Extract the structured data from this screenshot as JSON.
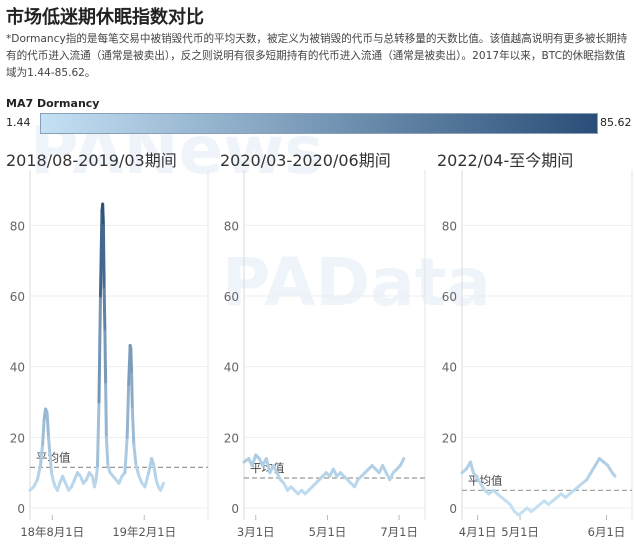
{
  "page": {
    "title": "市场低迷期休眠指数对比",
    "description": "*Dormancy指的是每笔交易中被销毁代币的平均天数，被定义为被销毁的代币与总转移量的天数比值。该值越高说明有更多被长期持有的代币进入流通（通常是被卖出），反之则说明有很多短期持有的代币进入流通（通常是被卖出）。2017年以来，BTC的休眠指数值域为1.44-85.62。"
  },
  "legend": {
    "title": "MA7 Dormancy",
    "min_label": "1.44",
    "max_label": "85.62",
    "color_low": "#c4e1f4",
    "color_high": "#2a4e78"
  },
  "watermarks": [
    "PANews",
    "PAData"
  ],
  "avg_label": "平均值",
  "chart_data": [
    {
      "type": "line",
      "title": "2018/08-2019/03期间",
      "ylim": [
        0,
        90
      ],
      "yticks": [
        0,
        20,
        40,
        60,
        80
      ],
      "xlim": [
        0,
        240
      ],
      "xticks": [
        {
          "x": 30,
          "label": "18年8月1日"
        },
        {
          "x": 154,
          "label": "19年2月1日"
        }
      ],
      "average": 11.5,
      "series": [
        {
          "points": [
            [
              0,
              5
            ],
            [
              5,
              6
            ],
            [
              10,
              8
            ],
            [
              14,
              12
            ],
            [
              17,
              18
            ],
            [
              19,
              25
            ],
            [
              21,
              28
            ],
            [
              23,
              27
            ],
            [
              25,
              20
            ],
            [
              27,
              15
            ],
            [
              29,
              10
            ],
            [
              31,
              8
            ],
            [
              34,
              6
            ],
            [
              37,
              5
            ],
            [
              40,
              7
            ],
            [
              44,
              9
            ],
            [
              48,
              7
            ],
            [
              52,
              5
            ],
            [
              56,
              6
            ],
            [
              60,
              8
            ],
            [
              64,
              10
            ],
            [
              68,
              9
            ],
            [
              72,
              7
            ],
            [
              76,
              8
            ],
            [
              80,
              10
            ],
            [
              84,
              9
            ],
            [
              87,
              6
            ],
            [
              89,
              8
            ],
            [
              91,
              12
            ],
            [
              93,
              30
            ],
            [
              95,
              60
            ],
            [
              97,
              84
            ],
            [
              98,
              86
            ],
            [
              99,
              80
            ],
            [
              100,
              62
            ],
            [
              101,
              50
            ],
            [
              102,
              35
            ],
            [
              103,
              20
            ],
            [
              105,
              12
            ],
            [
              108,
              10
            ],
            [
              112,
              9
            ],
            [
              116,
              8
            ],
            [
              120,
              7
            ],
            [
              124,
              9
            ],
            [
              128,
              10
            ],
            [
              131,
              20
            ],
            [
              133,
              35
            ],
            [
              135,
              46
            ],
            [
              136,
              45
            ],
            [
              137,
              38
            ],
            [
              138,
              28
            ],
            [
              140,
              18
            ],
            [
              143,
              12
            ],
            [
              147,
              9
            ],
            [
              151,
              7
            ],
            [
              155,
              6
            ],
            [
              160,
              10
            ],
            [
              164,
              14
            ],
            [
              167,
              12
            ],
            [
              170,
              8
            ],
            [
              173,
              6
            ],
            [
              176,
              5
            ],
            [
              180,
              7
            ]
          ]
        }
      ]
    },
    {
      "type": "line",
      "title": "2020/03-2020/06期间",
      "ylim": [
        0,
        90
      ],
      "yticks": [
        0,
        20,
        40,
        60,
        80
      ],
      "xlim": [
        0,
        154
      ],
      "xticks": [
        {
          "x": 10,
          "label": "3月1日"
        },
        {
          "x": 71,
          "label": "5月1日"
        },
        {
          "x": 132,
          "label": "7月1日"
        }
      ],
      "average": 8.5,
      "series": [
        {
          "points": [
            [
              0,
              13
            ],
            [
              4,
              14
            ],
            [
              7,
              12
            ],
            [
              10,
              15
            ],
            [
              13,
              14
            ],
            [
              16,
              12
            ],
            [
              19,
              14
            ],
            [
              22,
              10
            ],
            [
              25,
              12
            ],
            [
              28,
              10
            ],
            [
              31,
              8
            ],
            [
              34,
              7
            ],
            [
              37,
              5
            ],
            [
              40,
              6
            ],
            [
              43,
              5
            ],
            [
              46,
              4
            ],
            [
              49,
              5
            ],
            [
              52,
              4
            ],
            [
              55,
              5
            ],
            [
              58,
              6
            ],
            [
              61,
              7
            ],
            [
              64,
              8
            ],
            [
              67,
              9
            ],
            [
              70,
              10
            ],
            [
              73,
              9
            ],
            [
              76,
              11
            ],
            [
              79,
              9
            ],
            [
              82,
              10
            ],
            [
              85,
              9
            ],
            [
              88,
              8
            ],
            [
              91,
              7
            ],
            [
              94,
              6
            ],
            [
              97,
              8
            ],
            [
              100,
              9
            ],
            [
              103,
              10
            ],
            [
              106,
              11
            ],
            [
              109,
              12
            ],
            [
              112,
              11
            ],
            [
              115,
              10
            ],
            [
              118,
              12
            ],
            [
              121,
              10
            ],
            [
              124,
              8
            ],
            [
              127,
              10
            ],
            [
              130,
              11
            ],
            [
              133,
              12
            ],
            [
              136,
              14
            ]
          ]
        }
      ]
    },
    {
      "type": "line",
      "title": "2022/04-至今期间",
      "ylim": [
        0,
        90
      ],
      "yticks": [
        0,
        20,
        40,
        60,
        80
      ],
      "xlim": [
        0,
        120
      ],
      "xticks": [
        {
          "x": 11,
          "label": "4月1日"
        },
        {
          "x": 41,
          "label": "5月1日"
        },
        {
          "x": 102,
          "label": "6月1日"
        }
      ],
      "average": 5,
      "series": [
        {
          "points": [
            [
              0,
              10
            ],
            [
              3,
              11
            ],
            [
              6,
              13
            ],
            [
              8,
              10
            ],
            [
              10,
              9
            ],
            [
              13,
              7
            ],
            [
              16,
              5
            ],
            [
              19,
              4
            ],
            [
              22,
              5
            ],
            [
              25,
              4
            ],
            [
              28,
              3
            ],
            [
              31,
              2
            ],
            [
              34,
              1
            ],
            [
              37,
              -1
            ],
            [
              40,
              -2
            ],
            [
              43,
              -1
            ],
            [
              46,
              0
            ],
            [
              49,
              -1
            ],
            [
              52,
              0
            ],
            [
              55,
              1
            ],
            [
              58,
              2
            ],
            [
              61,
              1
            ],
            [
              64,
              2
            ],
            [
              67,
              3
            ],
            [
              70,
              4
            ],
            [
              73,
              3
            ],
            [
              76,
              4
            ],
            [
              79,
              5
            ],
            [
              82,
              6
            ],
            [
              85,
              7
            ],
            [
              88,
              8
            ],
            [
              91,
              10
            ],
            [
              94,
              12
            ],
            [
              97,
              14
            ],
            [
              100,
              13
            ],
            [
              103,
              12
            ],
            [
              106,
              10
            ],
            [
              108,
              9
            ]
          ]
        }
      ]
    }
  ]
}
